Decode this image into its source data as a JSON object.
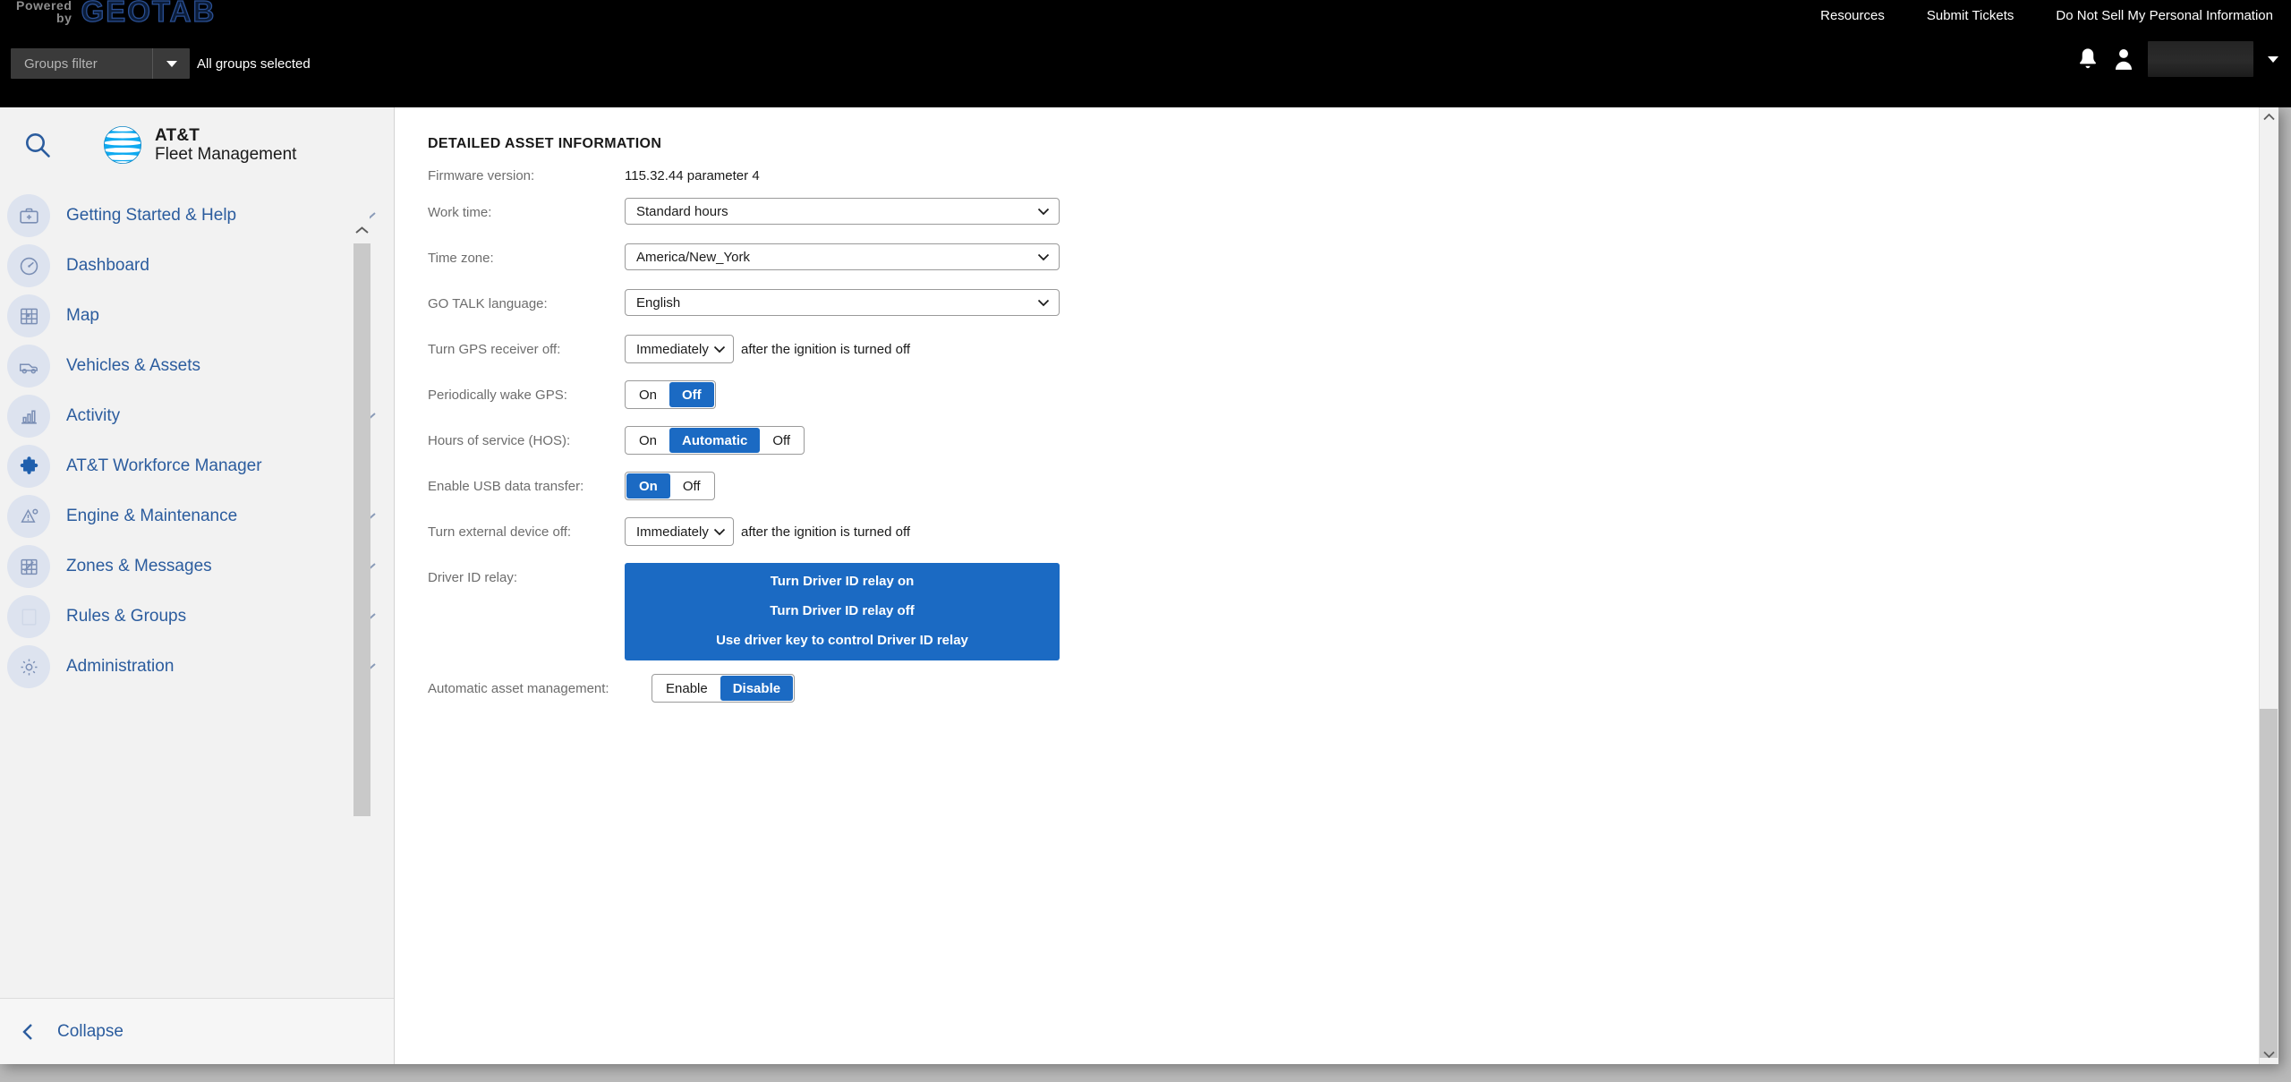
{
  "topbar": {
    "geotab_powered": "Powered",
    "geotab_by": "by",
    "geotab_word": "GEOTAB",
    "groups_filter_placeholder": "Groups filter",
    "groups_selected_text": "All groups selected",
    "links": [
      {
        "label": "Resources",
        "name": "resources-link"
      },
      {
        "label": "Submit Tickets",
        "name": "submit-tickets-link"
      },
      {
        "label": "Do Not Sell My Personal Information",
        "name": "do-not-sell-link"
      }
    ],
    "notifications_icon": "bell-icon",
    "user_icon": "person-icon",
    "user_name": ""
  },
  "sidebar": {
    "search_icon": "search-icon",
    "brand_name": "AT&T",
    "brand_sub": "Fleet Management",
    "items": [
      {
        "label": "Getting Started & Help",
        "icon": "briefcase-help-icon",
        "expandable": true
      },
      {
        "label": "Dashboard",
        "icon": "gauge-icon",
        "expandable": false
      },
      {
        "label": "Map",
        "icon": "map-icon",
        "expandable": false
      },
      {
        "label": "Vehicles & Assets",
        "icon": "vehicle-icon",
        "expandable": false
      },
      {
        "label": "Activity",
        "icon": "bar-chart-icon",
        "expandable": true
      },
      {
        "label": "AT&T Workforce Manager",
        "icon": "puzzle-icon",
        "expandable": false
      },
      {
        "label": "Engine & Maintenance",
        "icon": "engine-warning-icon",
        "expandable": true
      },
      {
        "label": "Zones & Messages",
        "icon": "zones-icon",
        "expandable": true
      },
      {
        "label": "Rules & Groups",
        "icon": "rules-icon",
        "expandable": true
      },
      {
        "label": "Administration",
        "icon": "gear-icon",
        "expandable": true
      }
    ],
    "collapse_label": "Collapse"
  },
  "main": {
    "section_title": "DETAILED ASSET INFORMATION",
    "rows": [
      {
        "label": "Firmware version:",
        "type": "static",
        "value": "115.32.44 parameter 4"
      },
      {
        "label": "Work time:",
        "type": "select-wide",
        "value": "Standard hours"
      },
      {
        "label": "Time zone:",
        "type": "select-wide",
        "value": "America/New_York"
      },
      {
        "label": "GO TALK language:",
        "type": "select-wide",
        "value": "English"
      },
      {
        "label": "Turn GPS receiver off:",
        "type": "select-small",
        "value": "Immediately",
        "suffix": "after the ignition is turned off"
      },
      {
        "label": "Periodically wake GPS:",
        "type": "segmented",
        "options": [
          "On",
          "Off"
        ],
        "selected": "Off"
      },
      {
        "label": "Hours of service (HOS):",
        "type": "segmented",
        "options": [
          "On",
          "Automatic",
          "Off"
        ],
        "selected": "Automatic"
      },
      {
        "label": "Enable USB data transfer:",
        "type": "segmented",
        "options": [
          "On",
          "Off"
        ],
        "selected": "On"
      },
      {
        "label": "Turn external device off:",
        "type": "select-small",
        "value": "Immediately",
        "suffix": "after the ignition is turned off"
      },
      {
        "label": "Driver ID relay:",
        "type": "relay-panel",
        "options": [
          "Turn Driver ID relay on",
          "Turn Driver ID relay off",
          "Use driver key to control Driver ID relay"
        ]
      },
      {
        "label": "Automatic asset management:",
        "type": "segmented",
        "options": [
          "Enable",
          "Disable"
        ],
        "selected": "Disable"
      }
    ]
  },
  "colors": {
    "accent_blue": "#1b6ac3",
    "nav_blue": "#2b5c9e",
    "topbar_black": "#000000",
    "sidebar_grey": "#f2f2f2"
  }
}
